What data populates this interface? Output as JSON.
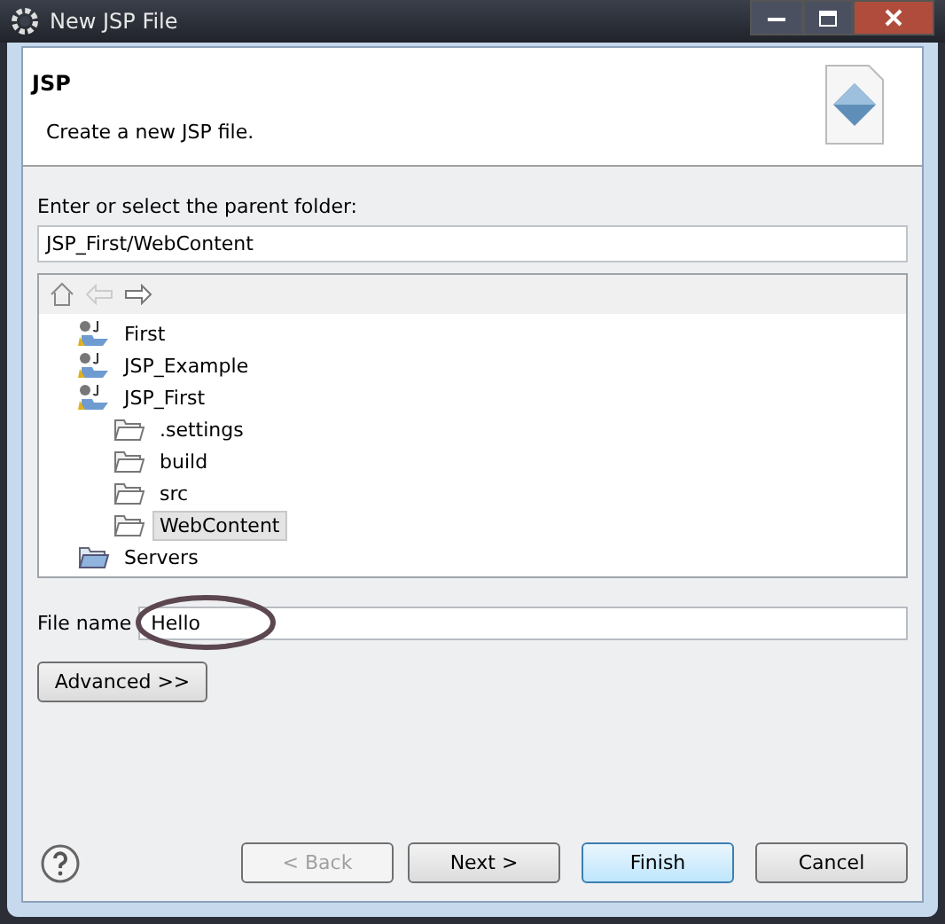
{
  "window": {
    "title": "New JSP File"
  },
  "header": {
    "title": "JSP",
    "description": "Create a new JSP file."
  },
  "folder_label": "Enter or select the parent folder:",
  "folder_value": "JSP_First/WebContent",
  "tree": [
    {
      "label": "First",
      "kind": "project",
      "selected": false
    },
    {
      "label": "JSP_Example",
      "kind": "project",
      "selected": false
    },
    {
      "label": "JSP_First",
      "kind": "project",
      "selected": false,
      "children": [
        {
          "label": ".settings",
          "kind": "folder",
          "selected": false
        },
        {
          "label": "build",
          "kind": "folder",
          "selected": false
        },
        {
          "label": "src",
          "kind": "folder",
          "selected": false
        },
        {
          "label": "WebContent",
          "kind": "folder",
          "selected": true
        }
      ]
    },
    {
      "label": "Servers",
      "kind": "servers",
      "selected": false
    }
  ],
  "file_name": {
    "label": "File name",
    "value": "Hello",
    "annotated": true
  },
  "advanced_button": "Advanced >>",
  "buttons": [
    {
      "label": "< Back",
      "disabled": true,
      "default": false
    },
    {
      "label": "Next >",
      "disabled": false,
      "default": false
    },
    {
      "label": "Finish",
      "disabled": false,
      "default": true
    },
    {
      "label": "Cancel",
      "disabled": false,
      "default": false
    }
  ]
}
